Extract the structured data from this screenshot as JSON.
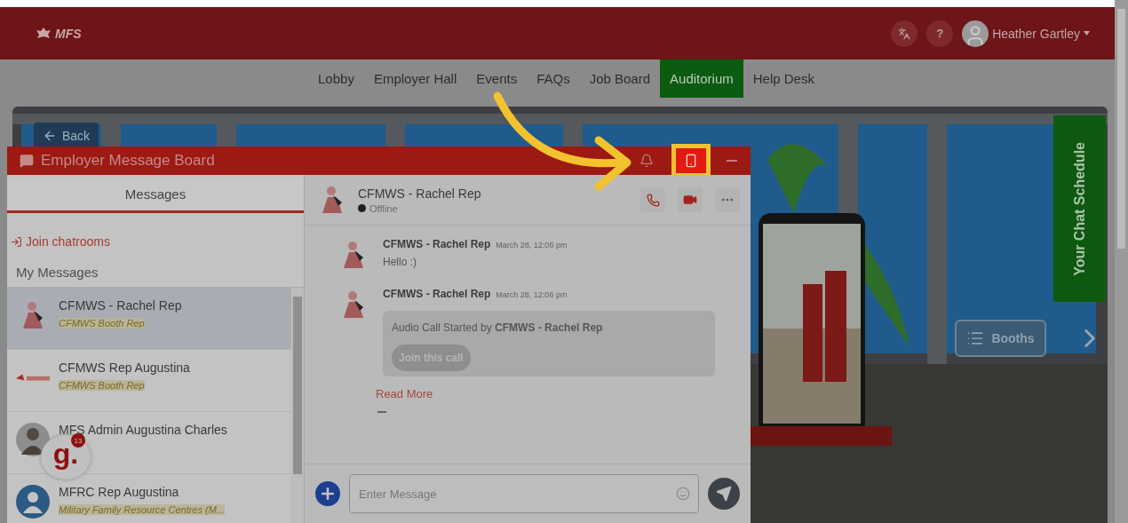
{
  "header": {
    "logo": "MFS",
    "help": "?",
    "user": "Heather Gartley"
  },
  "nav": [
    {
      "label": "Lobby",
      "selected": false
    },
    {
      "label": "Employer Hall",
      "selected": false
    },
    {
      "label": "Events",
      "selected": false
    },
    {
      "label": "FAQs",
      "selected": false
    },
    {
      "label": "Job Board",
      "selected": false
    },
    {
      "label": "Auditorium",
      "selected": true
    },
    {
      "label": "Help Desk",
      "selected": false
    }
  ],
  "back": "Back",
  "board": {
    "title": "Employer Message Board",
    "tab": "Messages",
    "join": "Join chatrooms",
    "section": "My Messages",
    "contacts": [
      {
        "name": "CFMWS - Rachel Rep",
        "role": "CFMWS Booth Rep",
        "selected": true,
        "kind": "figure"
      },
      {
        "name": "CFMWS Rep Augustina",
        "role": "CFMWS Booth Rep",
        "selected": false,
        "kind": "logo"
      },
      {
        "name": "MFS Admin Augustina Charles",
        "selected": false
      },
      {
        "name": "MFRC Rep Augustina",
        "role": "Military Family Resource Centres (M...",
        "selected": false,
        "kind": "silhouette"
      }
    ],
    "conversation": {
      "name": "CFMWS - Rachel Rep",
      "status": "Offline",
      "online": false,
      "messages": [
        {
          "kind": "text",
          "author": "CFMWS - Rachel Rep",
          "time": "March 28, 12:06 pm",
          "text": "Hello :)"
        },
        {
          "kind": "call",
          "author": "CFMWS - Rachel Rep",
          "time": "March 28, 12:06 pm",
          "text": "Audio Call Started by **CFMWS - Rachel Rep**",
          "action": "Join this call"
        }
      ],
      "read_more": "Read More",
      "input": {
        "placeholder": "Enter Message"
      }
    }
  },
  "badge": {
    "logo": "g.",
    "count": "13"
  },
  "schedule": "Your Chat Schedule",
  "booths": "Booths"
}
